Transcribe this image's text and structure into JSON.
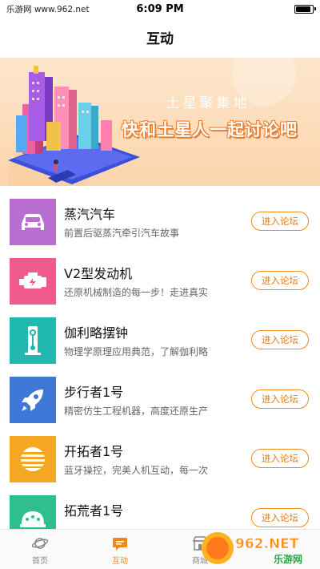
{
  "status_bar": {
    "left_text": "乐游网 www.962.net",
    "time": "6:09 PM"
  },
  "page": {
    "title": "互动"
  },
  "banner": {
    "title": "土星聚集地",
    "subtitle": "快和土星人一起讨论吧"
  },
  "enter_label": "进入论坛",
  "items": [
    {
      "title": "蒸汽汽车",
      "desc": "前置后驱蒸汽牵引汽车故事",
      "icon": "car-icon",
      "color": "#b86fd0"
    },
    {
      "title": "V2型发动机",
      "desc": "还原机械制造的每一步！走进真实",
      "icon": "engine-icon",
      "color": "#f05a8c"
    },
    {
      "title": "伽利略摆钟",
      "desc": "物理学原理应用典范，了解伽利略",
      "icon": "pendulum-icon",
      "color": "#21b8b0"
    },
    {
      "title": "步行者1号",
      "desc": "精密仿生工程机器，高度还原生产",
      "icon": "rocket-icon",
      "color": "#3f78d6"
    },
    {
      "title": "开拓者1号",
      "desc": "蓝牙操控，完美人机互动，每一次",
      "icon": "striped-sun-icon",
      "color": "#f5a623"
    },
    {
      "title": "拓荒者1号",
      "desc": "",
      "icon": "dome-icon",
      "color": "#2fbf8f"
    }
  ],
  "tabbar": {
    "tabs": [
      {
        "label": "首页",
        "icon": "planet-icon"
      },
      {
        "label": "互动",
        "icon": "chat-icon",
        "active": true
      },
      {
        "label": "商城",
        "icon": "store-icon"
      }
    ]
  },
  "watermark": {
    "text": "962.NET",
    "subtext": "乐游网"
  }
}
